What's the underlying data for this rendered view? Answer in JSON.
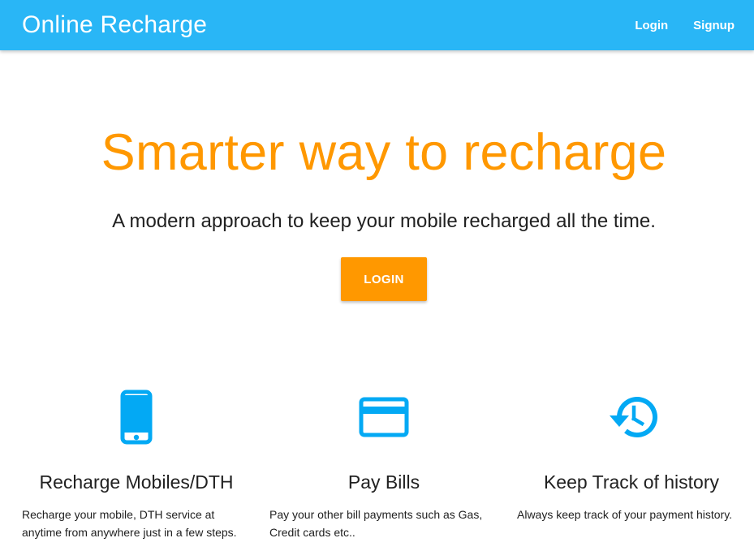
{
  "navbar": {
    "brand": "Online Recharge",
    "links": [
      "Login",
      "Signup"
    ],
    "background_color": "#29b6f6"
  },
  "hero": {
    "title": "Smarter way to recharge",
    "subtitle": "A modern approach to keep your mobile recharged all the time.",
    "button_label": "LOGIN",
    "accent_color": "#ff9800"
  },
  "features": [
    {
      "icon": "smartphone-icon",
      "title": "Recharge Mobiles/DTH",
      "description": "Recharge your mobile, DTH service at anytime from anywhere just in a few steps."
    },
    {
      "icon": "credit-card-icon",
      "title": "Pay Bills",
      "description": "Pay your other bill payments such as Gas, Credit cards etc.."
    },
    {
      "icon": "history-icon",
      "title": "Keep Track of history",
      "description": "Always keep track of your payment history."
    }
  ],
  "icon_color": "#03a9f4"
}
